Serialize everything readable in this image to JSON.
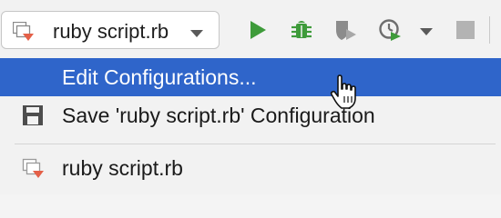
{
  "toolbar": {
    "run_config": {
      "label": "ruby script.rb",
      "icon": "ruby-run-config-icon",
      "dropdown_icon": "chevron-down-icon"
    },
    "buttons": [
      {
        "name": "run",
        "icon": "play-icon",
        "color": "#3e9b3a"
      },
      {
        "name": "debug",
        "icon": "bug-icon",
        "color": "#3e9b3a"
      },
      {
        "name": "coverage",
        "icon": "coverage-shield-icon",
        "color": "#8c8c8c"
      },
      {
        "name": "profile",
        "icon": "profiler-clock-icon",
        "color": "#6e6e6e"
      },
      {
        "name": "more",
        "icon": "chevron-down-icon",
        "color": "#5a5a5a"
      },
      {
        "name": "stop",
        "icon": "stop-icon",
        "color": "#b3b3b3"
      }
    ]
  },
  "menu": {
    "items": [
      {
        "label": "Edit Configurations...",
        "selected": true,
        "icon": ""
      },
      {
        "label": "Save 'ruby script.rb' Configuration",
        "selected": false,
        "icon": "floppy-disk-icon"
      },
      {
        "label": "ruby script.rb",
        "selected": false,
        "icon": "ruby-run-config-icon"
      }
    ]
  },
  "colors": {
    "selection": "#2f65ca",
    "ruby_red": "#e46048"
  }
}
